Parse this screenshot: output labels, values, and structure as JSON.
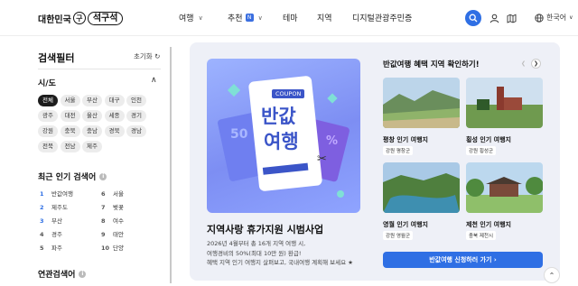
{
  "header": {
    "logo_left": "대한민국",
    "logo_mark": "구",
    "logo_right": "석구석",
    "nav": [
      {
        "label": "여행",
        "has_dropdown": true
      },
      {
        "label": "추천",
        "has_dropdown": true,
        "badge": "N"
      },
      {
        "label": "테마",
        "has_dropdown": false
      },
      {
        "label": "지역",
        "has_dropdown": false
      },
      {
        "label": "디지털관광주민증",
        "has_dropdown": false
      }
    ],
    "language": "한국어",
    "accent_color": "#2f6fe4"
  },
  "sidebar": {
    "title": "검색필터",
    "reset_label": "초기화",
    "region_section": "시/도",
    "regions": [
      "전체",
      "서울",
      "부산",
      "대구",
      "인천",
      "광주",
      "대전",
      "울산",
      "세종",
      "경기",
      "강원",
      "충북",
      "충남",
      "경북",
      "경남",
      "전북",
      "전남",
      "제주"
    ],
    "selected_region": "전체",
    "popular_title": "최근 인기 검색어",
    "popular": [
      {
        "rank": "1",
        "term": "반값여행"
      },
      {
        "rank": "2",
        "term": "제주도"
      },
      {
        "rank": "3",
        "term": "부산"
      },
      {
        "rank": "4",
        "term": "경주"
      },
      {
        "rank": "5",
        "term": "파주"
      },
      {
        "rank": "6",
        "term": "서울"
      },
      {
        "rank": "7",
        "term": "벚꽃"
      },
      {
        "rank": "8",
        "term": "여수"
      },
      {
        "rank": "9",
        "term": "태안"
      },
      {
        "rank": "10",
        "term": "단양"
      }
    ],
    "related_title": "연관검색어"
  },
  "banner": {
    "coupon": "COUPON",
    "line1": "반값",
    "line2": "여행",
    "deco_left": "50",
    "deco_right": "%"
  },
  "event": {
    "title": "지역사랑 휴가지원 시범사업",
    "desc1": "2026년 4월부터 총 16개 지역 여행 시,",
    "desc2": "여행경비의 50%(최대 10만 원) 환급!",
    "desc3": "혜택 지역 인기 여행지 살펴보고, 국내여행 계획해 보세요"
  },
  "right": {
    "title": "반값여행 혜택 지역 확인하기!",
    "cards": [
      {
        "title": "평창 인기 여행지",
        "tag": "강원 평창군"
      },
      {
        "title": "횡성 인기 여행지",
        "tag": "강원 횡성군"
      },
      {
        "title": "영월 인기 여행지",
        "tag": "강원 영월군"
      },
      {
        "title": "제천 인기 여행지",
        "tag": "충북 제천시"
      }
    ],
    "cta_label": "반값여행 신청하러 가기"
  }
}
